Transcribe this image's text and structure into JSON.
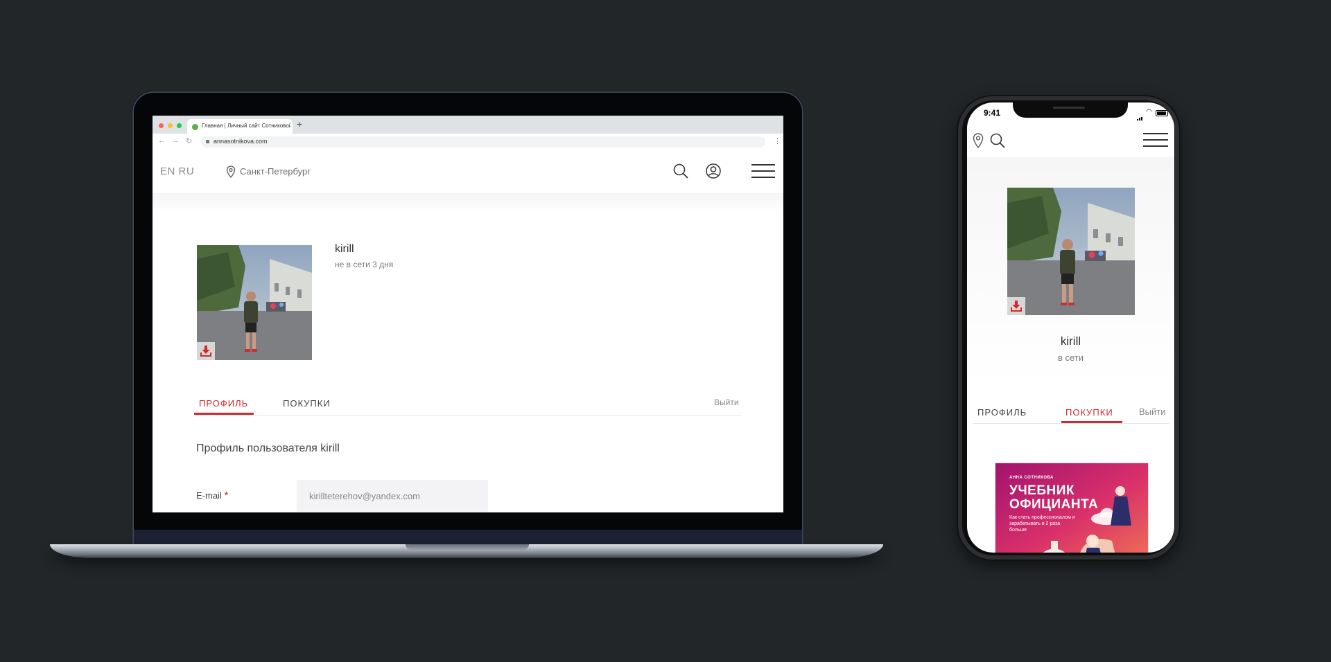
{
  "browser": {
    "tab_title": "Главная | Личный сайт Сотниковой",
    "new_tab": "+",
    "url": "annasotnikova.com",
    "kebab": "⋮"
  },
  "desktop": {
    "header": {
      "lang": "EN RU",
      "city": "Санкт-Петербург"
    },
    "profile": {
      "name": "kirill",
      "status": "не в сети 3 дня"
    },
    "tabs": {
      "profile": "ПРОФИЛЬ",
      "purchases": "ПОКУПКИ",
      "logout": "Выйти"
    },
    "form": {
      "title": "Профиль пользователя kirill",
      "email_label": "E-mail",
      "required_mark": "*",
      "email_value": "kirillteterehov@yandex.com"
    }
  },
  "mobile": {
    "status_bar": {
      "time": "9:41"
    },
    "profile": {
      "name": "kirill",
      "status": "в сети"
    },
    "tabs": {
      "profile": "ПРОФИЛЬ",
      "purchases": "ПОКУПКИ",
      "logout": "Выйти"
    },
    "book": {
      "author": "АННА СОТНИКОВА",
      "title_line1": "УЧЕБНИК",
      "title_line2": "ОФИЦИАНТА",
      "subtitle": "Как стать профессионалом и зарабатывать в 2 раза больше"
    }
  },
  "colors": {
    "background": "#222628",
    "accent_red": "#d4282d",
    "text_dark": "#333333",
    "text_muted": "#777777"
  },
  "icons": [
    "location-pin-icon",
    "search-icon",
    "user-icon",
    "hamburger-menu-icon",
    "download-icon",
    "lock-icon",
    "back-arrow-icon",
    "forward-arrow-icon",
    "reload-icon"
  ]
}
